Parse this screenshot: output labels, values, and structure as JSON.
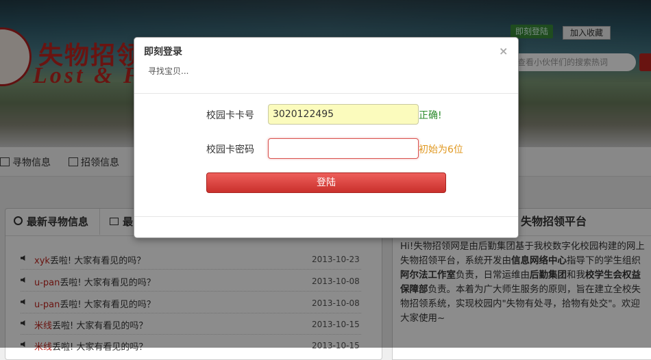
{
  "header": {
    "logo_cn": "失物招领",
    "logo_en": "Lost & F",
    "login_button": "即刻登陆",
    "favorite_button": "加入收藏",
    "search_placeholder": "查看小伙伴们的搜索热词"
  },
  "nav": {
    "items": [
      {
        "label": "寻物信息",
        "icon": "list-icon"
      },
      {
        "label": "招领信息",
        "icon": "image-icon"
      }
    ]
  },
  "tabs": {
    "active": "最新寻物信息",
    "second": "最"
  },
  "list": [
    {
      "user": "xyk",
      "text": "丢啦! 大家有看见的吗？",
      "date": "2013-10-23"
    },
    {
      "user": "u-pan",
      "text": "丢啦! 大家有看见的吗？",
      "date": "2013-10-08"
    },
    {
      "user": "u-pan",
      "text": "丢啦! 大家有看见的吗？",
      "date": "2013-10-08"
    },
    {
      "user": "米线",
      "text": "丢啦! 大家有看见的吗？",
      "date": "2013-10-15"
    },
    {
      "user": "米线",
      "text": "丢啦! 大家有看见的吗？",
      "date": "2013-10-15"
    }
  ],
  "about": {
    "title": "失物招领平台",
    "p1": "Hi!失物招领网是由后勤集团基于我校数字化校园构建的网上失物招领平台，系统开发由",
    "b1": "信息网络中心",
    "p2": "指导下的学生组织",
    "b2": "阿尔法工作室",
    "p3": "负责，日常运维由",
    "b3": "后勤集团",
    "p4": "和我",
    "b4": "校学生会权益保障部",
    "p5": "负责。本着为广大师生服务的原则，旨在建立全校失物招领系统，实现校园内\"失物有处寻，拾物有处交\"。欢迎大家使用~"
  },
  "modal": {
    "title": "即刻登录",
    "subtitle": "寻找宝贝...",
    "close": "×",
    "card_label": "校园卡卡号",
    "card_value": "3020122495",
    "card_hint": "正确!",
    "password_label": "校园卡密码",
    "password_value": "",
    "password_hint": "初始为6位",
    "submit": "登陆"
  },
  "colors": {
    "brand_red": "#c0261f",
    "ok_green": "#2a8a2a",
    "warn_orange": "#e09820"
  }
}
